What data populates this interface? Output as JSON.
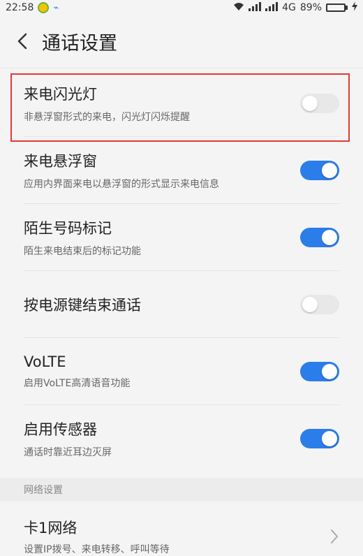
{
  "status_bar": {
    "time": "22:58",
    "network": "4G",
    "battery_percent": "89%",
    "battery_level": 0.89,
    "icons": [
      "green-circle-notification-icon",
      "usb-icon",
      "wifi-icon",
      "signal-icon",
      "battery-icon",
      "charging-icon"
    ]
  },
  "header": {
    "title": "通话设置",
    "back_icon": "chevron-left-icon"
  },
  "settings": [
    {
      "title": "来电闪光灯",
      "subtitle": "非悬浮窗形式的来电，闪光灯闪烁提醒",
      "enabled": false,
      "highlighted": true
    },
    {
      "title": "来电悬浮窗",
      "subtitle": "应用内界面来电以悬浮窗的形式显示来电信息",
      "enabled": true
    },
    {
      "title": "陌生号码标记",
      "subtitle": "陌生来电结束后的标记功能",
      "enabled": true
    },
    {
      "title": "按电源键结束通话",
      "subtitle": "",
      "enabled": false
    },
    {
      "title": "VoLTE",
      "subtitle": "启用VoLTE高清语音功能",
      "enabled": true
    },
    {
      "title": "启用传感器",
      "subtitle": "通话时靠近耳边灭屏",
      "enabled": true
    }
  ],
  "network_section": {
    "header": "网络设置",
    "card1": {
      "title": "卡1网络",
      "subtitle": "设置IP拨号、来电转移、呼叫等待"
    }
  },
  "colors": {
    "accent": "#2b7de9",
    "toggle_off": "#e8e8e8",
    "highlight": "#e53935",
    "background": "#f4f4f4"
  }
}
